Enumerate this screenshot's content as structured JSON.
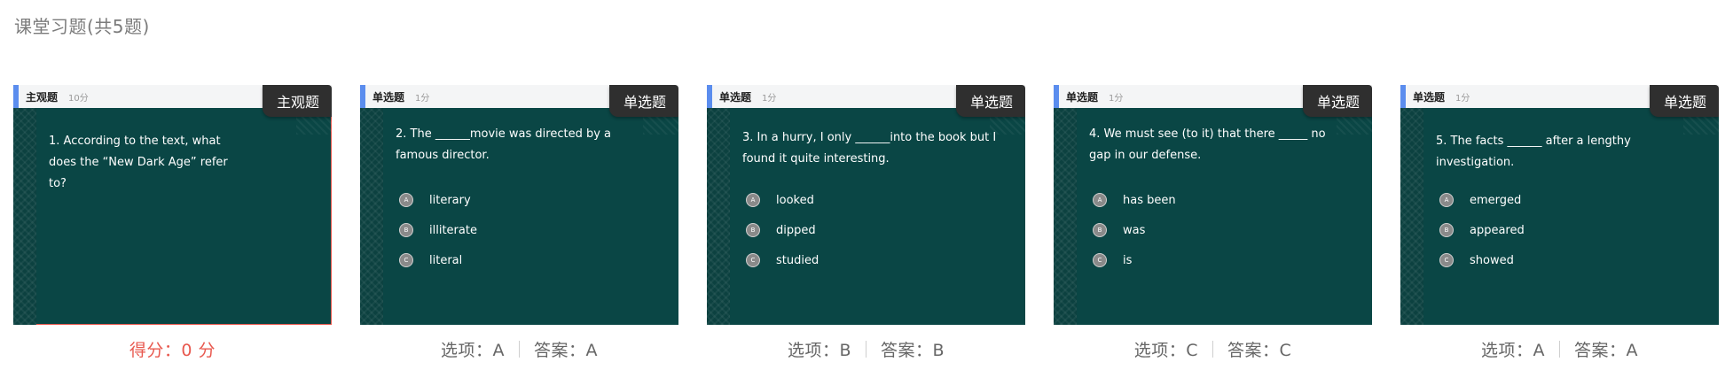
{
  "page_title": "课堂习题(共5题)",
  "cards": [
    {
      "type_label": "主观题",
      "score_label": "10分",
      "badge": "主观题",
      "question": "1. According to the text, what does the “New Dark Age” refer to?",
      "options": [],
      "result": {
        "score_text": "得分：0 分"
      }
    },
    {
      "type_label": "单选题",
      "score_label": "1分",
      "badge": "单选题",
      "question": "2. The ______movie was directed by a famous director.",
      "options": [
        {
          "letter": "A",
          "text": "literary"
        },
        {
          "letter": "B",
          "text": "illiterate"
        },
        {
          "letter": "C",
          "text": "literal"
        }
      ],
      "result": {
        "choice": "选项：A",
        "answer": "答案：A"
      }
    },
    {
      "type_label": "单选题",
      "score_label": "1分",
      "badge": "单选题",
      "question": "3. In a hurry, I only ______into the book but I found it quite interesting.",
      "options": [
        {
          "letter": "A",
          "text": "looked"
        },
        {
          "letter": "B",
          "text": "dipped"
        },
        {
          "letter": "C",
          "text": "studied"
        }
      ],
      "result": {
        "choice": "选项：B",
        "answer": "答案：B"
      }
    },
    {
      "type_label": "单选题",
      "score_label": "1分",
      "badge": "单选题",
      "question": "4. We must see (to it) that there _____ no gap in our defense.",
      "options": [
        {
          "letter": "A",
          "text": "has been"
        },
        {
          "letter": "B",
          "text": "was"
        },
        {
          "letter": "C",
          "text": "is"
        }
      ],
      "result": {
        "choice": "选项：C",
        "answer": "答案：C"
      }
    },
    {
      "type_label": "单选题",
      "score_label": "1分",
      "badge": "单选题",
      "question": "5. The facts ______ after a lengthy investigation.",
      "options": [
        {
          "letter": "A",
          "text": "emerged"
        },
        {
          "letter": "B",
          "text": "appeared"
        },
        {
          "letter": "C",
          "text": "showed"
        }
      ],
      "result": {
        "choice": "选项：A",
        "answer": "答案：A"
      }
    }
  ],
  "colors": {
    "card_bg": "#0a4645",
    "accent": "#5b8dee",
    "score_red": "#e8584e",
    "badge_bg": "#2f2f2f"
  }
}
